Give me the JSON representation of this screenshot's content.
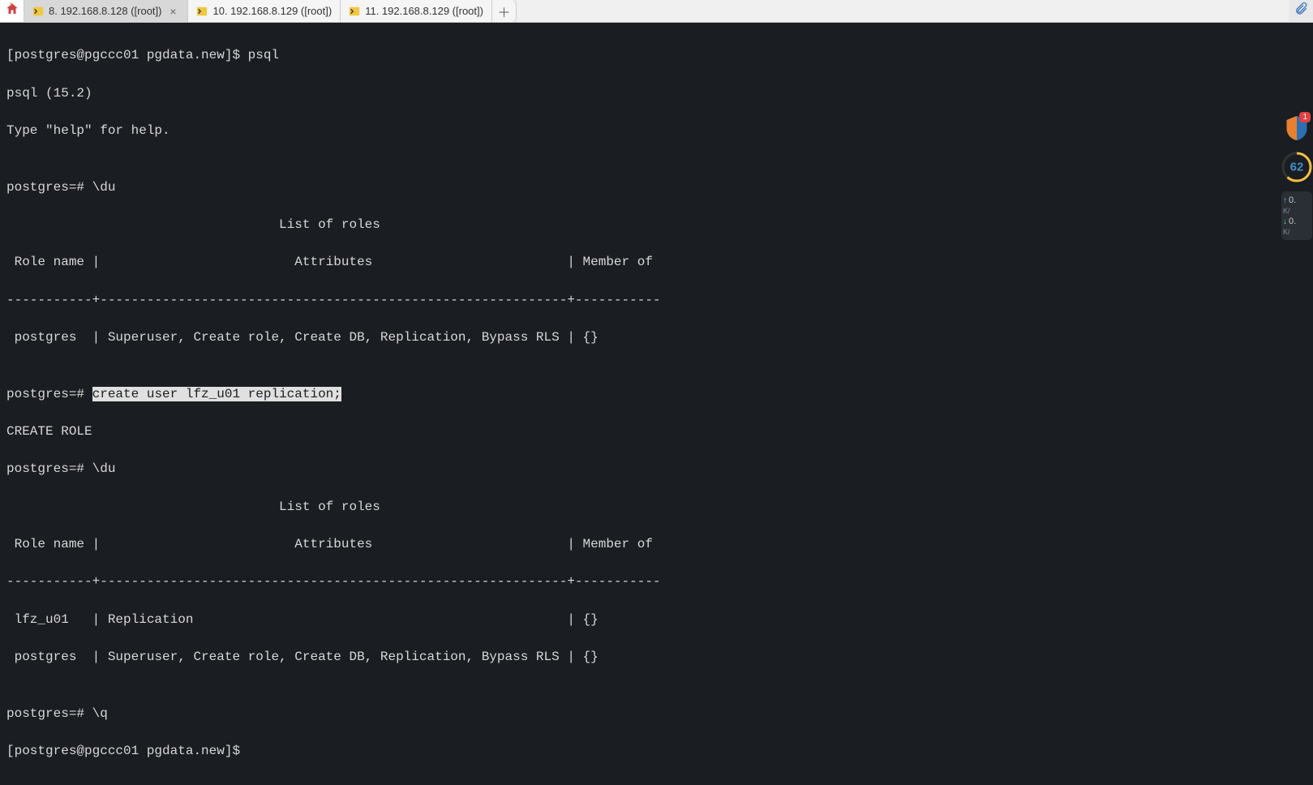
{
  "tabs": [
    {
      "label": "8. 192.168.8.128 ([root])",
      "active": true
    },
    {
      "label": "10. 192.168.8.129 ([root])",
      "active": false
    },
    {
      "label": "11. 192.168.8.129 ([root])",
      "active": false
    }
  ],
  "terminal": {
    "l1": "[postgres@pgccc01 pgdata.new]$ psql",
    "l2": "psql (15.2)",
    "l3": "Type \"help\" for help.",
    "l4": "",
    "l5": "postgres=# \\du",
    "l6": "                                   List of roles",
    "l7": " Role name |                         Attributes                         | Member of ",
    "l8": "-----------+------------------------------------------------------------+-----------",
    "l9": " postgres  | Superuser, Create role, Create DB, Replication, Bypass RLS | {}",
    "l10": "",
    "l11a": "postgres=# ",
    "l11b": "create user lfz_u01 replication;",
    "l12": "CREATE ROLE",
    "l13": "postgres=# \\du",
    "l14": "                                   List of roles",
    "l15": " Role name |                         Attributes                         | Member of ",
    "l16": "-----------+------------------------------------------------------------+-----------",
    "l17": " lfz_u01   | Replication                                                | {}",
    "l18": " postgres  | Superuser, Create role, Create DB, Replication, Bypass RLS | {}",
    "l19": "",
    "l20": "postgres=# \\q",
    "l21": "[postgres@pgccc01 pgdata.new]$ "
  },
  "sidebar": {
    "shield_count": "1",
    "gauge_value": "62",
    "up_val": "0.",
    "up_unit": "K/",
    "down_val": "0.",
    "down_unit": "K/"
  }
}
